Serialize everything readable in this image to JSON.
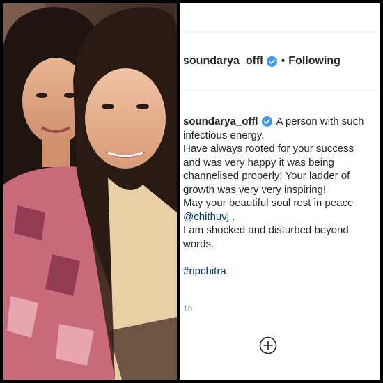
{
  "post": {
    "username": "soundarya_offl",
    "follow_status": "Following",
    "separator": "•",
    "caption": {
      "first_line_text": "A person with such",
      "lines": [
        "infectious energy.",
        "Have always rooted for your success",
        "and was very happy it was being",
        "channelised properly! Your ladder of",
        "growth was very very inspiring!",
        "May your beautiful soul rest in peace"
      ],
      "mention": "@chithuvj",
      "mention_suffix": " .",
      "lines_after": [
        "I am shocked and disturbed beyond",
        "words."
      ],
      "hashtag": "#ripchitra"
    },
    "timestamp": "1h"
  },
  "icons": {
    "verified": "verified-badge-icon",
    "add_comment": "plus-circle-icon"
  },
  "colors": {
    "verified_blue": "#3897f0",
    "link_blue": "#00376b",
    "text": "#262626",
    "muted": "#8e8e8e"
  }
}
